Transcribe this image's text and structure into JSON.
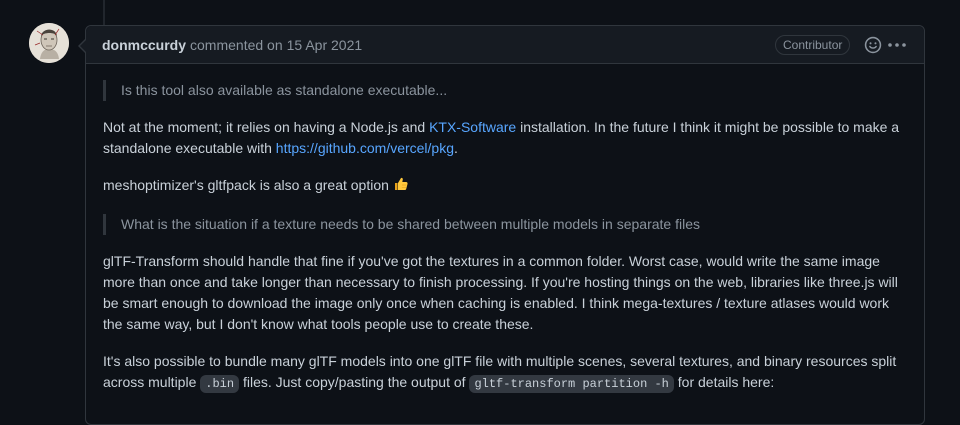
{
  "comment": {
    "author": "donmccurdy",
    "action": "commented on",
    "date": "15 Apr 2021",
    "role_badge": "Contributor",
    "icons": {
      "reaction": "smiley-icon",
      "more": "kebab-horizontal-icon",
      "thumbs_up": "thumbs-up-emoji"
    },
    "quote1": "Is this tool also available as standalone executable...",
    "p1": {
      "text1": "Not at the moment; it relies on having a Node.js and ",
      "link1": "KTX-Software",
      "text2": " installation. In the future I think it might be possible to make a standalone executable with ",
      "link2": "https://github.com/vercel/pkg",
      "text3": "."
    },
    "p2": {
      "text": "meshoptimizer's gltfpack is also a great option "
    },
    "quote2": "What is the situation if a texture needs to be shared between multiple models in separate files",
    "p3": "glTF-Transform should handle that fine if you've got the textures in a common folder. Worst case, would write the same image more than once and take longer than necessary to finish processing. If you're hosting things on the web, libraries like three.js will be smart enough to download the image only once when caching is enabled. I think mega-textures / texture atlases would work the same way, but I don't know what tools people use to create these.",
    "p4": {
      "text1": "It's also possible to bundle many glTF models into one glTF file with multiple scenes, several textures, and binary resources split across multiple ",
      "code1": ".bin",
      "text2": " files. Just copy/pasting the output of ",
      "code2": "gltf-transform partition -h",
      "text3": " for details here:"
    }
  },
  "colors": {
    "background": "#0d1117",
    "header_bg": "#161b22",
    "border": "#30363d",
    "link": "#58a6ff",
    "muted": "#8b949e",
    "text": "#c9d1d9"
  }
}
